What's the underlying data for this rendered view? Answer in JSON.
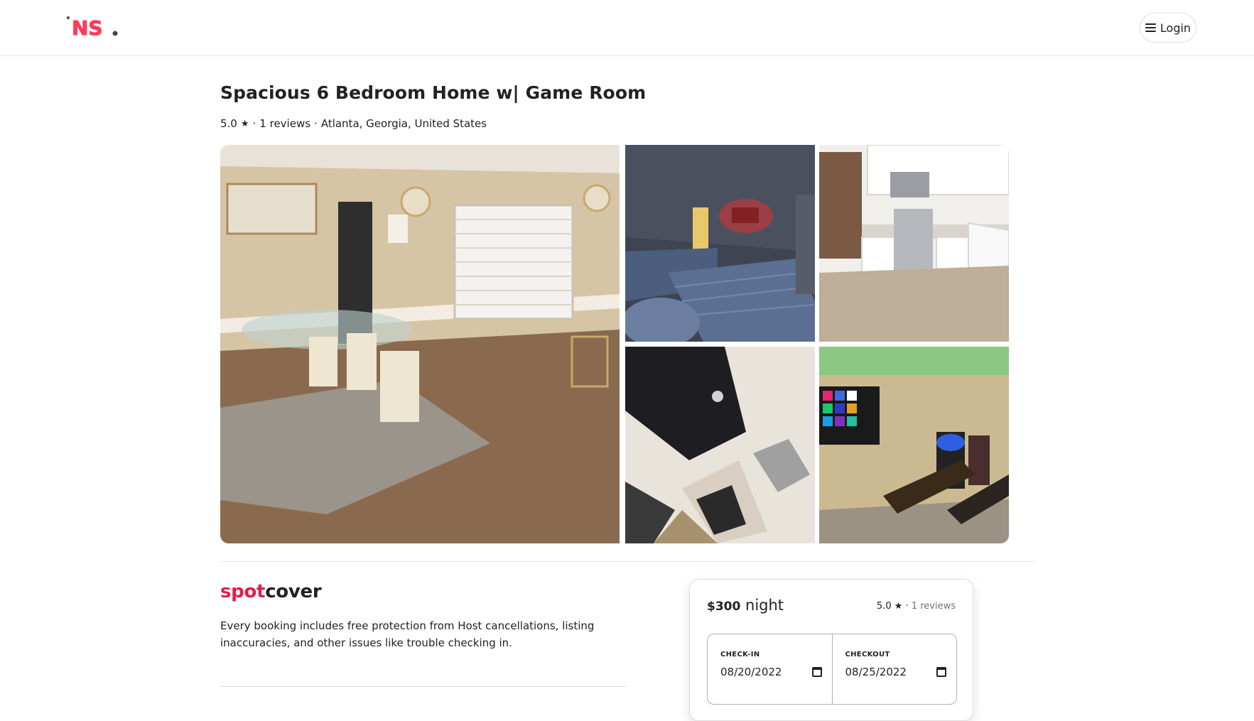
{
  "header": {
    "logo_text": "NS.",
    "login_label": "Login"
  },
  "listing": {
    "title": "Spacious 6 Bedroom Home w| Game Room",
    "rating": "5.0",
    "reviews": "1 reviews",
    "location": "Atlanta, Georgia, United States"
  },
  "gallery": {
    "photos": [
      "dining-room",
      "bedroom",
      "kitchen",
      "living-room-tv",
      "game-room"
    ]
  },
  "cover": {
    "brand_part1": "spot",
    "brand_part2": "cover",
    "description": "Every booking includes free protection from Host cancellations, listing inaccuracies, and other issues like trouble checking in."
  },
  "booking": {
    "price": "$300",
    "per": "night",
    "rating": "5.0",
    "reviews": "1 reviews",
    "checkin_label": "CHECK-IN",
    "checkin_value": "08/20/2022",
    "checkout_label": "CHECKOUT",
    "checkout_value": "08/25/2022"
  },
  "colors": {
    "brand": "#e51d4a",
    "text": "#222222",
    "muted": "#717171"
  }
}
